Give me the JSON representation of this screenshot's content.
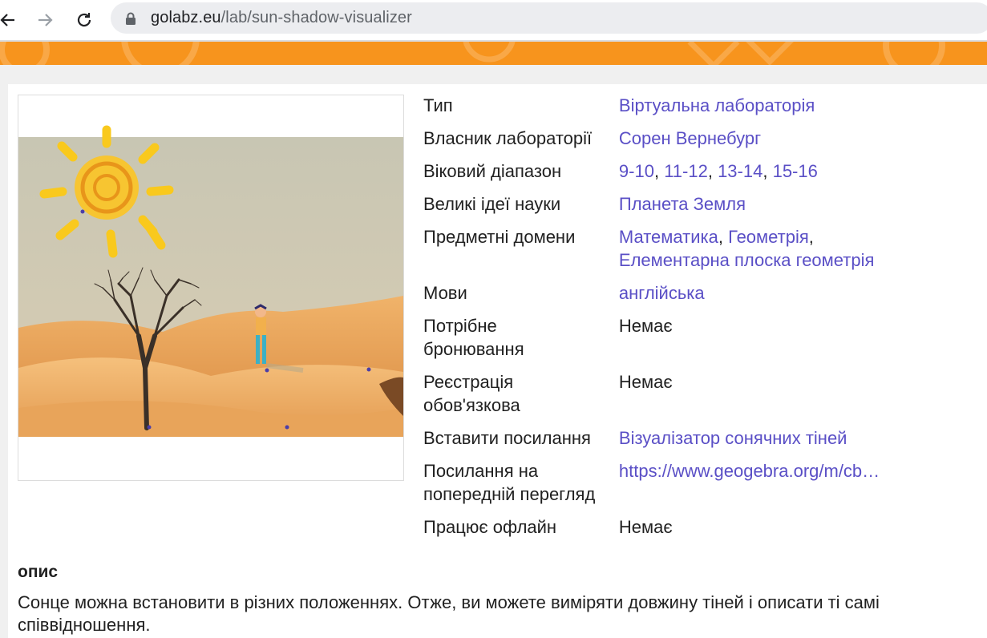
{
  "browser": {
    "url_domain": "golabz.eu",
    "url_path": "/lab/sun-shadow-visualizer",
    "back_icon": "arrow-left-icon",
    "forward_icon": "arrow-right-icon",
    "reload_icon": "reload-icon",
    "lock_icon": "lock-icon"
  },
  "colors": {
    "banner": "#f7941d",
    "link": "#5a4fc6",
    "text": "#212121"
  },
  "lab": {
    "image_icon": "sun-desert-shadow-illustration",
    "properties": {
      "type": {
        "label": "Тип",
        "value": "Віртуальна лабораторія"
      },
      "owner": {
        "label": "Власник лабораторії",
        "value": "Сорен Вернебург"
      },
      "age": {
        "label": "Віковий діапазон",
        "values": [
          "9-10",
          "11-12",
          "13-14",
          "15-16"
        ]
      },
      "big_ideas": {
        "label": "Великі ідеї науки",
        "value": "Планета Земля"
      },
      "domains": {
        "label": "Предметні домени",
        "values": [
          "Математика",
          "Геометрія",
          "Елементарна плоска геометрія"
        ]
      },
      "languages": {
        "label": "Мови",
        "value": "англійська"
      },
      "booking": {
        "label_line1": "Потрібне",
        "label_line2": "бронювання",
        "value": "Немає"
      },
      "registration": {
        "label_line1": "Реєстрація",
        "label_line2": "обов'язкова",
        "value": "Немає"
      },
      "embed": {
        "label": "Вставити посилання",
        "value": "Візуалізатор сонячних тіней"
      },
      "preview": {
        "label_line1": "Посилання на",
        "label_line2": "попередній перегляд",
        "value": "https://www.geogebra.org/m/cb…"
      },
      "offline": {
        "label": "Працює офлайн",
        "value": "Немає"
      }
    }
  },
  "description": {
    "title": "опис",
    "text": "Сонце можна встановити в різних положеннях. Отже, ви можете виміряти довжину тіней і описати ті самі співвідношення."
  }
}
